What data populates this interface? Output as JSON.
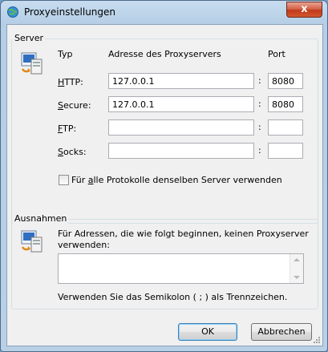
{
  "window": {
    "title": "Proxyeinstellungen",
    "close_label": "x"
  },
  "server": {
    "group_label": "Server",
    "col_type": "Typ",
    "col_address": "Adresse des Proxyservers",
    "col_port": "Port",
    "rows": [
      {
        "label_first": "H",
        "label_rest": "TTP:",
        "address": "127.0.0.1",
        "port": "8080"
      },
      {
        "label_first": "S",
        "label_rest": "ecure:",
        "address": "127.0.0.1",
        "port": "8080"
      },
      {
        "label_first": "F",
        "label_rest": "TP:",
        "address": "",
        "port": ""
      },
      {
        "label_first": "S",
        "label_rest": "ocks:",
        "address": "",
        "port": ""
      }
    ],
    "same_server_first": "Für ",
    "same_server_access": "a",
    "same_server_rest": "lle Protokolle denselben Server verwenden",
    "same_server_checked": false
  },
  "exceptions": {
    "group_label": "Ausnahmen",
    "description_line1": "Für Adressen, die wie folgt beginnen, keinen Proxyserver",
    "description_line2": "verwenden:",
    "value": "",
    "hint": "Verwenden Sie das Semikolon ( ; ) als Trennzeichen."
  },
  "buttons": {
    "ok": "OK",
    "cancel": "Abbrechen"
  },
  "colors": {
    "title_bar": "#b9d0e6",
    "close_button": "#c2391c",
    "dialog_bg": "#f0f0f0"
  }
}
